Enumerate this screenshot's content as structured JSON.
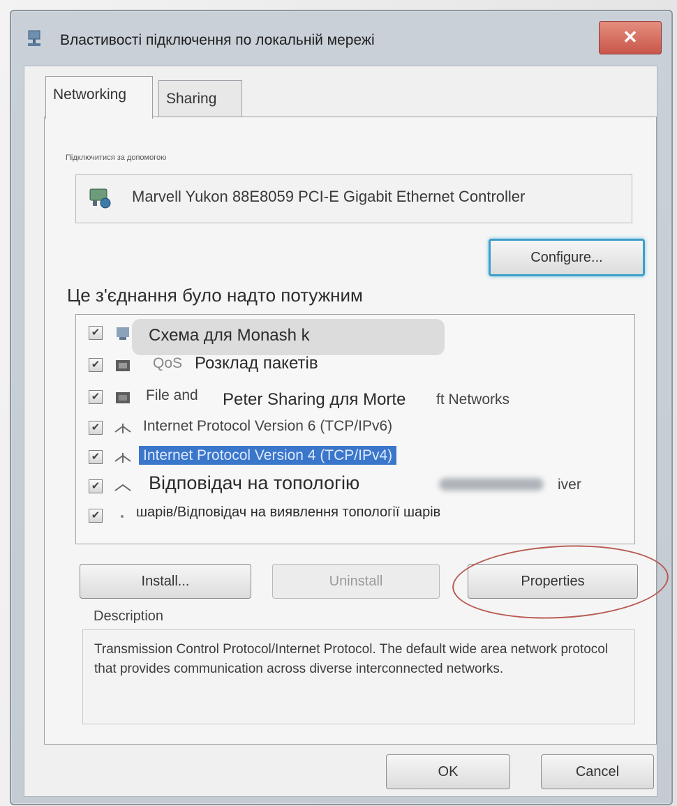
{
  "window": {
    "title": "Властивості підключення по локальній мережі",
    "close_glyph": "✕"
  },
  "tabs": [
    {
      "label": "Networking",
      "active": true
    },
    {
      "label": "Sharing",
      "active": false
    }
  ],
  "connect_using": {
    "label": "Підключитися за допомогою",
    "adapter": "Marvell Yukon 88E8059 PCI-E Gigabit Ethernet Controller",
    "configure_label": "Configure..."
  },
  "overlay_heading": "Це з'єднання було надто потужним",
  "items": [
    {
      "checked": true,
      "icon": "client-icon",
      "text": "",
      "overlay": "Схема для Monash k"
    },
    {
      "checked": true,
      "icon": "qos-icon",
      "text": "QoS",
      "overlay": "Розклад пакетів"
    },
    {
      "checked": true,
      "icon": "share-icon",
      "text": "File and",
      "overlay": "Peter Sharing для Morte",
      "suffix": "ft Networks"
    },
    {
      "checked": true,
      "icon": "protocol-icon",
      "text": "Internet Protocol Version 6 (TCP/IPv6)"
    },
    {
      "checked": true,
      "icon": "protocol-icon",
      "text": "Internet Protocol Version 4 (TCP/IPv4)",
      "selected": true
    },
    {
      "checked": true,
      "icon": "protocol-icon",
      "text": "",
      "overlay": "Відповідач на топологію",
      "suffix": "iver"
    },
    {
      "checked": true,
      "icon": "dot-icon",
      "text": "",
      "overlay": "шарів/Відповідач на виявлення топології шарів"
    }
  ],
  "buttons": {
    "install": "Install...",
    "uninstall": "Uninstall",
    "properties": "Properties",
    "ok": "OK",
    "cancel": "Cancel"
  },
  "description": {
    "label": "Description",
    "text": "Transmission Control Protocol/Internet Protocol. The default wide area network protocol that provides communication across diverse interconnected networks."
  },
  "colors": {
    "selection": "#3a76c9",
    "configure_focus": "#3d9fc8",
    "annotation_ring": "#b85a52"
  }
}
